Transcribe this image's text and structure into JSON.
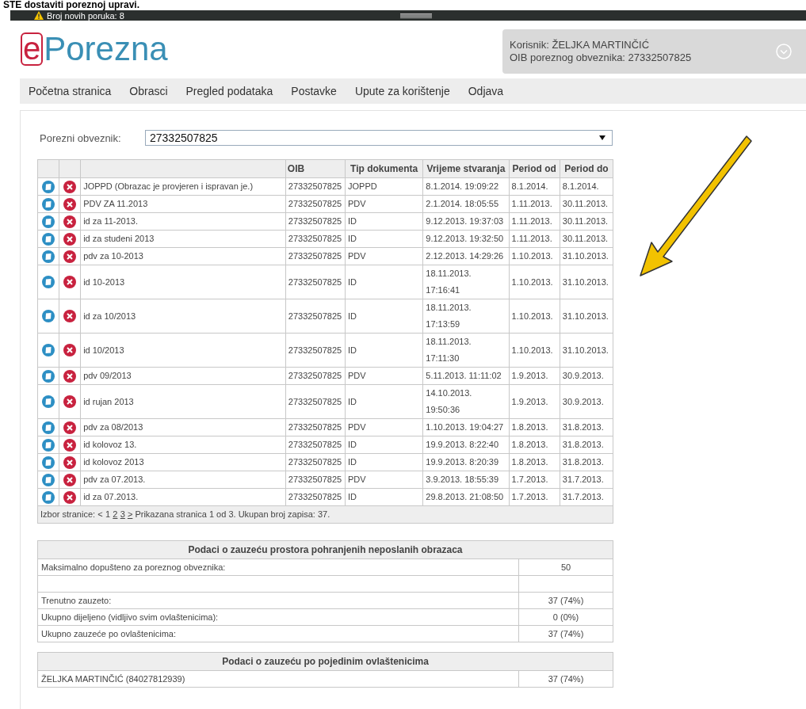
{
  "top_caption": "STE dostaviti poreznoj upravi.",
  "message_bar": {
    "text": "Broj novih poruka: 8"
  },
  "logo": {
    "prefix": "e",
    "name": "Porezna"
  },
  "user": {
    "name_line": "Korisnik: ŽELJKA MARTINČIĆ",
    "oib_line": "OIB poreznog obveznika: 27332507825"
  },
  "nav": [
    "Početna stranica",
    "Obrasci",
    "Pregled podataka",
    "Postavke",
    "Upute za korištenje",
    "Odjava"
  ],
  "taxpayer": {
    "label": "Porezni obveznik:",
    "value": "27332507825"
  },
  "documents": {
    "columns": [
      "OIB",
      "Tip dokumenta",
      "Vrijeme stvaranja",
      "Period od",
      "Period do"
    ],
    "rows": [
      {
        "name": "JOPPD (Obrazac je provjeren i ispravan je.)",
        "oib": "27332507825",
        "type": "JOPPD",
        "created": "8.1.2014. 19:09:22",
        "from": "8.1.2014.",
        "to": "8.1.2014."
      },
      {
        "name": "PDV ZA 11.2013",
        "oib": "27332507825",
        "type": "PDV",
        "created": "2.1.2014. 18:05:55",
        "from": "1.11.2013.",
        "to": "30.11.2013."
      },
      {
        "name": "id za 11-2013.",
        "oib": "27332507825",
        "type": "ID",
        "created": "9.12.2013. 19:37:03",
        "from": "1.11.2013.",
        "to": "30.11.2013."
      },
      {
        "name": "id za studeni 2013",
        "oib": "27332507825",
        "type": "ID",
        "created": "9.12.2013. 19:32:50",
        "from": "1.11.2013.",
        "to": "30.11.2013."
      },
      {
        "name": "pdv za 10-2013",
        "oib": "27332507825",
        "type": "PDV",
        "created": "2.12.2013. 14:29:26",
        "from": "1.10.2013.",
        "to": "31.10.2013."
      },
      {
        "name": "id 10-2013",
        "oib": "27332507825",
        "type": "ID",
        "created": "18.11.2013. 17:16:41",
        "from": "1.10.2013.",
        "to": "31.10.2013."
      },
      {
        "name": "id za 10/2013",
        "oib": "27332507825",
        "type": "ID",
        "created": "18.11.2013. 17:13:59",
        "from": "1.10.2013.",
        "to": "31.10.2013."
      },
      {
        "name": "id 10/2013",
        "oib": "27332507825",
        "type": "ID",
        "created": "18.11.2013. 17:11:30",
        "from": "1.10.2013.",
        "to": "31.10.2013."
      },
      {
        "name": "pdv 09/2013",
        "oib": "27332507825",
        "type": "PDV",
        "created": "5.11.2013. 11:11:02",
        "from": "1.9.2013.",
        "to": "30.9.2013."
      },
      {
        "name": "id rujan 2013",
        "oib": "27332507825",
        "type": "ID",
        "created": "14.10.2013. 19:50:36",
        "from": "1.9.2013.",
        "to": "30.9.2013."
      },
      {
        "name": "pdv za 08/2013",
        "oib": "27332507825",
        "type": "PDV",
        "created": "1.10.2013. 19:04:27",
        "from": "1.8.2013.",
        "to": "31.8.2013."
      },
      {
        "name": "id kolovoz 13.",
        "oib": "27332507825",
        "type": "ID",
        "created": "19.9.2013. 8:22:40",
        "from": "1.8.2013.",
        "to": "31.8.2013."
      },
      {
        "name": "id kolovoz 2013",
        "oib": "27332507825",
        "type": "ID",
        "created": "19.9.2013. 8:20:39",
        "from": "1.8.2013.",
        "to": "31.8.2013."
      },
      {
        "name": "pdv za 07.2013.",
        "oib": "27332507825",
        "type": "PDV",
        "created": "3.9.2013. 18:55:39",
        "from": "1.7.2013.",
        "to": "31.7.2013."
      },
      {
        "name": "id za 07.2013.",
        "oib": "27332507825",
        "type": "ID",
        "created": "29.8.2013. 21:08:50",
        "from": "1.7.2013.",
        "to": "31.7.2013."
      }
    ]
  },
  "pagination": {
    "label": "Izbor stranice:",
    "prev": "<",
    "pages": [
      {
        "label": "1",
        "selected": true
      },
      {
        "label": "2",
        "selected": false
      },
      {
        "label": "3",
        "selected": false
      }
    ],
    "next": ">",
    "summary": "Prikazana stranica 1 od 3. Ukupan broj zapisa: 37."
  },
  "storage": {
    "title": "Podaci o zauzeću prostora pohranjenih neposlanih obrazaca",
    "rows": [
      {
        "kind": "data",
        "label": "Maksimalno dopušteno za poreznog obveznika:",
        "value": "50"
      },
      {
        "kind": "spacer"
      },
      {
        "kind": "data",
        "label": "Trenutno zauzeto:",
        "value": "37 (74%)"
      },
      {
        "kind": "data",
        "label": "Ukupno dijeljeno (vidljivo svim ovlaštenicima):",
        "value": "0 (0%)"
      },
      {
        "kind": "data",
        "label": "Ukupno zauzeće po ovlaštenicima:",
        "value": "37 (74%)"
      }
    ]
  },
  "per_user": {
    "title": "Podaci o zauzeću po pojedinim ovlaštenicima",
    "rows": [
      {
        "kind": "data",
        "label": "ŽELJKA MARTINČIĆ (84027812939)",
        "value": "37 (74%)"
      }
    ]
  }
}
